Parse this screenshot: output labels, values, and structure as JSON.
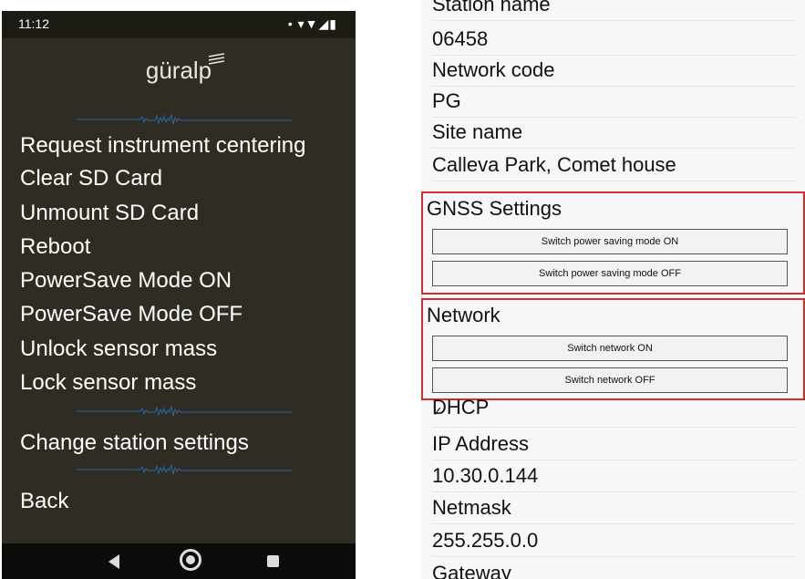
{
  "status_bar": {
    "time": "11:12",
    "icons": "• ▾▼◢▮"
  },
  "logo": {
    "text": "güralp"
  },
  "menu": {
    "items": [
      "Request instrument centering",
      "Clear SD Card",
      "Unmount SD Card",
      "Reboot",
      "PowerSave Mode ON",
      "PowerSave Mode OFF",
      "Unlock sensor mass",
      "Lock sensor mass"
    ],
    "change_station": "Change station settings",
    "back": "Back"
  },
  "settings": {
    "station_name_label": "Station name",
    "station_name_value": "06458",
    "network_code_label": "Network code",
    "network_code_value": "PG",
    "site_name_label": "Site name",
    "site_name_value": "Calleva Park, Comet house",
    "gnss": {
      "title": "GNSS Settings",
      "btn_on": "Switch power saving mode ON",
      "btn_off": "Switch power saving mode OFF"
    },
    "network": {
      "title": "Network",
      "btn_on": "Switch network ON",
      "btn_off": "Switch network OFF"
    },
    "dhcp_label": "DHCP",
    "ip_label": "IP Address",
    "ip_value": "10.30.0.144",
    "netmask_label": "Netmask",
    "netmask_value": "255.255.0.0",
    "gateway_label": "Gateway"
  }
}
